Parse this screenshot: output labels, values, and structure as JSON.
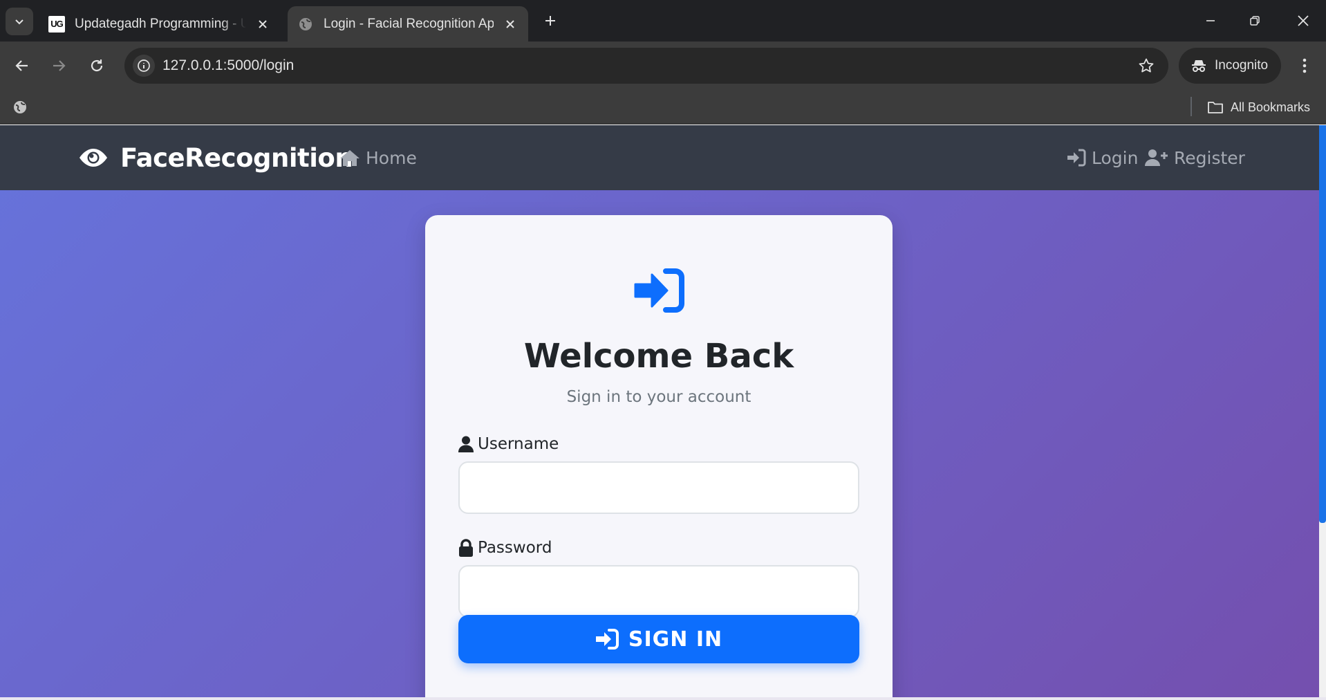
{
  "browser": {
    "tabs": [
      {
        "title": "Updategadh Programming - Up",
        "favicon": "UG",
        "active": false
      },
      {
        "title": "Login - Facial Recognition App",
        "favicon": "globe-icon",
        "active": true
      }
    ],
    "url": "127.0.0.1:5000/login",
    "profile_label": "Incognito",
    "bookmarks_label": "All Bookmarks"
  },
  "app": {
    "brand": "FaceRecognition",
    "nav": {
      "home": "Home",
      "login": "Login",
      "register": "Register"
    }
  },
  "login_card": {
    "title": "Welcome Back",
    "subtitle": "Sign in to your account",
    "username_label": "Username",
    "username_value": "",
    "password_label": "Password",
    "password_value": "",
    "submit_label": "SIGN IN"
  },
  "colors": {
    "accent": "#0d6efd",
    "navbar": "#353b47",
    "gradient_start": "#6673db",
    "gradient_end": "#744fae"
  }
}
